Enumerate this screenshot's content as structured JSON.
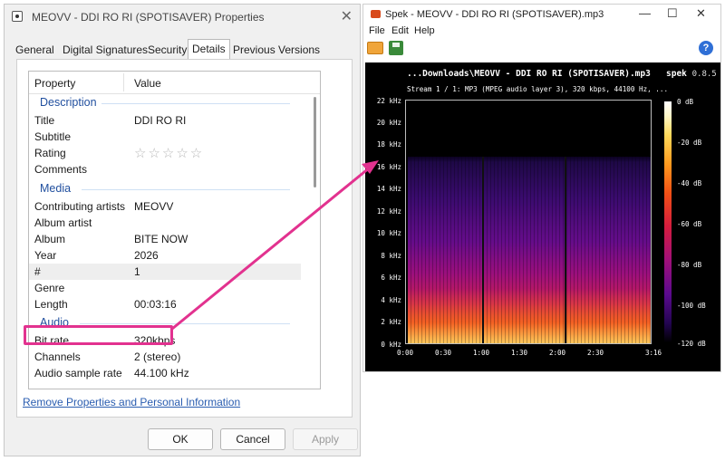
{
  "properties_window": {
    "title": "MEOVV - DDI RO RI (SPOTISAVER) Properties",
    "tabs": [
      {
        "label": "General"
      },
      {
        "label": "Digital Signatures"
      },
      {
        "label": "Security"
      },
      {
        "label": "Details",
        "active": true
      },
      {
        "label": "Previous Versions"
      }
    ],
    "columns": {
      "property": "Property",
      "value": "Value"
    },
    "sections": {
      "description": "Description",
      "media": "Media",
      "audio": "Audio"
    },
    "rows": [
      {
        "key": "Title",
        "value": "DDI RO RI"
      },
      {
        "key": "Subtitle",
        "value": ""
      },
      {
        "key": "Rating",
        "value": "☆☆☆☆☆"
      },
      {
        "key": "Comments",
        "value": ""
      },
      {
        "key": "Contributing artists",
        "value": "MEOVV"
      },
      {
        "key": "Album artist",
        "value": ""
      },
      {
        "key": "Album",
        "value": "BITE NOW"
      },
      {
        "key": "Year",
        "value": "2026"
      },
      {
        "key": "#",
        "value": "1"
      },
      {
        "key": "Genre",
        "value": ""
      },
      {
        "key": "Length",
        "value": "00:03:16"
      },
      {
        "key": "Bit rate",
        "value": "320kbps"
      },
      {
        "key": "Channels",
        "value": "2 (stereo)"
      },
      {
        "key": "Audio sample rate",
        "value": "44.100 kHz"
      }
    ],
    "remove_link": "Remove Properties and Personal Information",
    "buttons": {
      "ok": "OK",
      "cancel": "Cancel",
      "apply": "Apply"
    },
    "rating_stars": 0
  },
  "spek_window": {
    "title": "Spek - MEOVV - DDI RO RI (SPOTISAVER).mp3",
    "controls": {
      "minimize": "—",
      "maximize": "☐",
      "close": "✕"
    },
    "menu": [
      "File",
      "Edit",
      "Help"
    ],
    "help_glyph": "?",
    "header_path": "...Downloads\\MEOVV - DDI RO RI (SPOTISAVER).mp3",
    "app_name": "spek",
    "version": "0.8.5",
    "stream_info": "Stream 1 / 1: MP3 (MPEG audio layer 3), 320 kbps, 44100 Hz, ...",
    "y_ticks": [
      "22 kHz",
      "20 kHz",
      "18 kHz",
      "16 kHz",
      "14 kHz",
      "12 kHz",
      "10 kHz",
      "8 kHz",
      "6 kHz",
      "4 kHz",
      "2 kHz",
      "0 kHz"
    ],
    "x_ticks": [
      "0:00",
      "0:30",
      "1:00",
      "1:30",
      "2:00",
      "2:30",
      "3:16"
    ],
    "db_ticks": [
      "0 dB",
      "-20 dB",
      "-40 dB",
      "-60 dB",
      "-80 dB",
      "-100 dB",
      "-120 dB"
    ],
    "spectrum_cutoff_khz": 17,
    "duration": "3:16"
  },
  "colors": {
    "highlight": "#e2328f",
    "link": "#2a5db0",
    "section_header": "#1f4e9e"
  }
}
